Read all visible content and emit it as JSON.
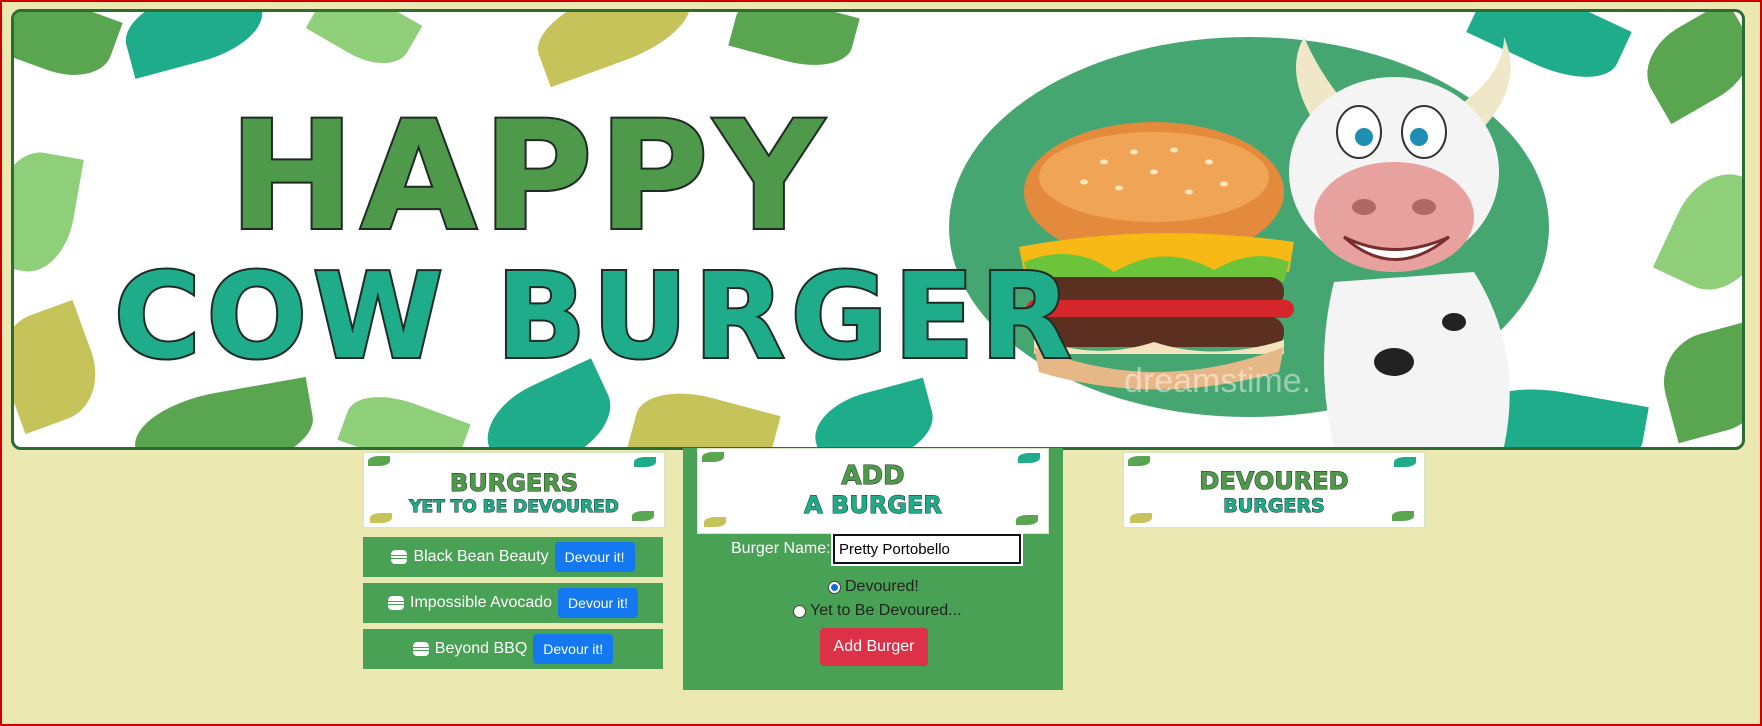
{
  "banner": {
    "title_line1": "HAPPY",
    "title_line2": "COW BURGER",
    "watermark": "dreamstime."
  },
  "columns": {
    "undevoured_header_line1": "BURGERS",
    "undevoured_header_line2": "YET TO BE DEVOURED",
    "add_header_line1": "ADD",
    "add_header_line2": "A BURGER",
    "devoured_header_line1": "DEVOURED",
    "devoured_header_line2": "BURGERS"
  },
  "burgers": [
    {
      "name": "Black Bean Beauty",
      "button": "Devour it!"
    },
    {
      "name": "Impossible Avocado",
      "button": "Devour it!"
    },
    {
      "name": "Beyond BBQ",
      "button": "Devour it!"
    }
  ],
  "form": {
    "name_label": "Burger Name:",
    "name_value": "Pretty Portobello",
    "radio_devoured": "Devoured!",
    "radio_not_devoured": "Yet to Be Devoured...",
    "selected_radio": "Devoured!",
    "submit_label": "Add Burger"
  },
  "colors": {
    "page_background": "#ece8b1",
    "panel_green": "#48a154",
    "devour_button": "#1478f0",
    "add_button": "#dc3147"
  },
  "icons": {
    "burger_item": "hamburger-icon"
  }
}
